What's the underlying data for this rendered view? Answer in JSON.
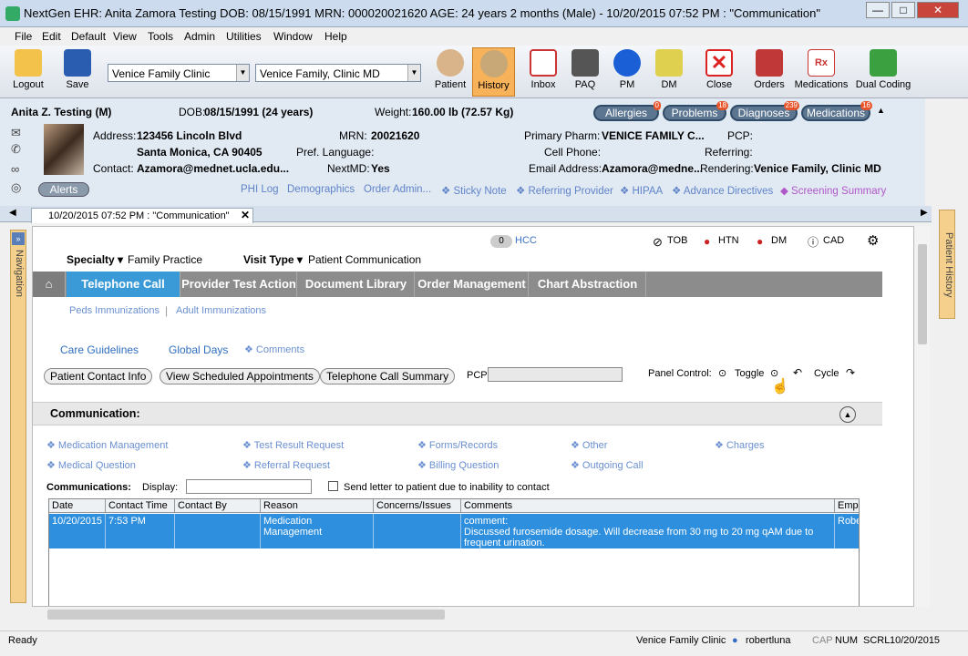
{
  "window": {
    "title": "NextGen EHR: Anita Zamora Testing  DOB: 08/15/1991  MRN: 000020021620  AGE: 24 years 2 months  (Male) - 10/20/2015 07:52 PM : \"Communication\"",
    "min": "—",
    "max": "□",
    "close": "✕"
  },
  "menu": [
    "File",
    "Edit",
    "Default",
    "View",
    "Tools",
    "Admin",
    "Utilities",
    "Window",
    "Help"
  ],
  "toolbar": {
    "logout": "Logout",
    "save": "Save",
    "location": "Venice Family Clinic",
    "provider": "Venice Family, Clinic MD",
    "buttons": [
      "Patient",
      "History",
      "Inbox",
      "PAQ",
      "PM",
      "DM",
      "Close",
      "Orders",
      "Medications",
      "Dual Coding"
    ]
  },
  "patient": {
    "name": "Anita Z. Testing (M)",
    "dob_label": "DOB:",
    "dob": "08/15/1991 (24 years)",
    "weight_label": "Weight:",
    "weight": "160.00 lb (72.57 Kg)",
    "address_label": "Address:",
    "address1": "123456 Lincoln Blvd",
    "address2": "Santa Monica, CA 90405",
    "contact_label": "Contact:",
    "contact": "Azamora@mednet.ucla.edu...",
    "mrn_label": "MRN:",
    "mrn": "20021620",
    "lang_label": "Pref. Language:",
    "lang": "",
    "nextmd_label": "NextMD:",
    "nextmd": "Yes",
    "pharm_label": "Primary Pharm:",
    "pharm": "VENICE FAMILY C...",
    "cell_label": "Cell Phone:",
    "cell": "",
    "email_label": "Email Address:",
    "email": "Azamora@medne...",
    "pcp_label": "PCP:",
    "pcp": "",
    "referring_label": "Referring:",
    "referring": "",
    "rendering_label": "Rendering:",
    "rendering": "Venice Family, Clinic MD",
    "alerts": "Alerts"
  },
  "pills": [
    {
      "label": "Allergies",
      "count": "0"
    },
    {
      "label": "Problems",
      "count": "18"
    },
    {
      "label": "Diagnoses",
      "count": "239"
    },
    {
      "label": "Medications",
      "count": "16"
    }
  ],
  "links": [
    "PHI Log",
    "Demographics",
    "Order Admin...",
    "❖ Sticky Note",
    "❖ Referring Provider",
    "❖ HIPAA",
    "❖ Advance Directives",
    "◆ Screening Summary"
  ],
  "doc_tab": "10/20/2015 07:52 PM : \"Communication\"",
  "side": {
    "left": "Navigation",
    "right": "Patient History"
  },
  "encounter": {
    "hcc_count": "0",
    "hcc": "HCC",
    "tob": "TOB",
    "htn": "HTN",
    "dm": "DM",
    "cad": "CAD",
    "specialty_label": "Specialty ▾",
    "specialty": "Family Practice",
    "visit_label": "Visit Type ▾",
    "visit": "Patient Communication"
  },
  "nav_tabs": [
    "Telephone Call",
    "Provider Test Action",
    "Document Library",
    "Order Management",
    "Chart Abstraction"
  ],
  "sub_links": [
    "Peds Immunizations",
    "Adult Immunizations"
  ],
  "care": {
    "guidelines": "Care Guidelines",
    "global": "Global Days",
    "comments": "❖ Comments"
  },
  "actions": [
    "Patient Contact Info",
    "View Scheduled Appointments",
    "Telephone Call Summary"
  ],
  "pcp_field": {
    "label": "PCP:",
    "value": ""
  },
  "panel": {
    "label": "Panel Control:",
    "toggle": "Toggle",
    "cycle": "Cycle"
  },
  "section": "Communication:",
  "comm_links": [
    "❖ Medication Management",
    "❖ Test Result Request",
    "❖ Forms/Records",
    "❖ Other",
    "❖ Charges",
    "❖ Medical Question",
    "❖ Referral Request",
    "❖ Billing Question",
    "❖ Outgoing Call"
  ],
  "comm": {
    "label": "Communications:",
    "display": "Display:",
    "letter": "Send letter to patient due to inability to contact"
  },
  "grid": {
    "columns": [
      "Date",
      "Contact Time",
      "Contact By",
      "Reason",
      "Concerns/Issues",
      "Comments",
      "Emplo"
    ],
    "row": [
      "10/20/2015",
      "7:53 PM",
      "",
      "Medication Management",
      "",
      "comment:\nDiscussed furosemide dosage. Will decrease from 30 mg to 20 mg qAM due to frequent urination.",
      "Robe"
    ]
  },
  "status": {
    "ready": "Ready",
    "clinic": "Venice Family Clinic",
    "user": "robertluna",
    "cap": "CAP",
    "num": "NUM",
    "scrl": "SCRL",
    "date": "10/20/2015"
  }
}
